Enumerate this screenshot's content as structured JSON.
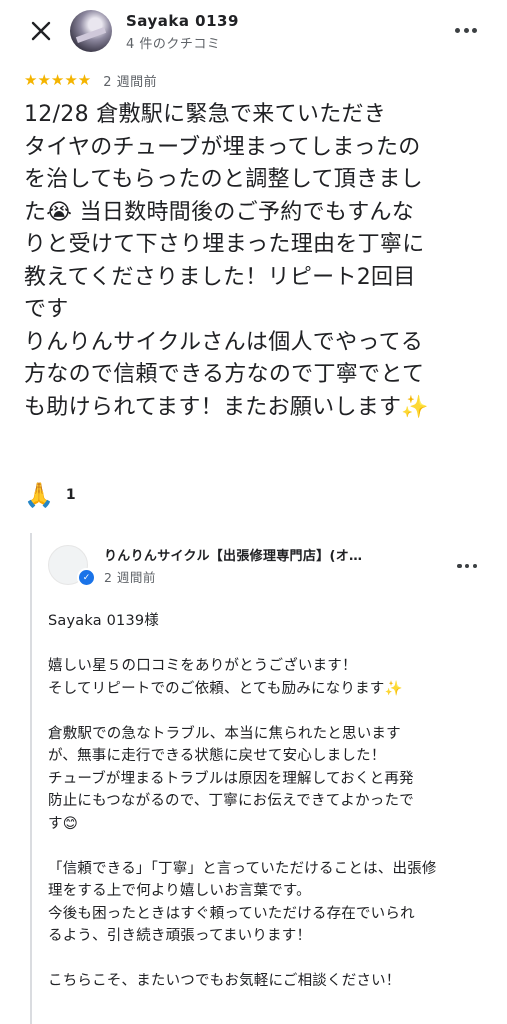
{
  "header": {
    "user_name": "Sayaka 0139",
    "user_meta": "4 件のクチコミ"
  },
  "review": {
    "stars": "★★★★★",
    "age": "2 週間前",
    "text": "12/28 倉敷駅に緊急で来ていただき\nタイヤのチューブが埋まってしまったの\nを治してもらったのと調整して頂きまし\nた😭 当日数時間後のご予約でもすんな\nりと受けて下さり埋まった理由を丁寧に\n教えてくださりました！リピート2回目\nです\nりんりんサイクルさんは個人でやってる\n方なので信頼できる方なので丁寧でとて\nも助けられてます！またお願いします✨",
    "reaction_emoji": "🙏",
    "reaction_count": "1"
  },
  "reply": {
    "owner_name": "りんりんサイクル【出張修理専門店】(オ…",
    "age": "2 週間前",
    "text": "Sayaka 0139様\n\n嬉しい星５の口コミをありがとうございます！\nそしてリピートでのご依頼、とても励みになります✨\n\n倉敷駅での急なトラブル、本当に焦られたと思います\nが、無事に走行できる状態に戻せて安心しました！\nチューブが埋まるトラブルは原因を理解しておくと再発\n防止にもつながるので、丁寧にお伝えできてよかったで\nす😊\n\n「信頼できる」「丁寧」と言っていただけることは、出張修\n理をする上で何より嬉しいお言葉です。\n今後も困ったときはすぐ頼っていただける存在でいられ\nるよう、引き続き頑張ってまいります！\n\nこちらこそ、またいつでもお気軽にご相談ください！"
  },
  "colors": {
    "star": "#f4b400",
    "verified": "#1a73e8",
    "text": "#202124",
    "muted": "#5f6368"
  }
}
